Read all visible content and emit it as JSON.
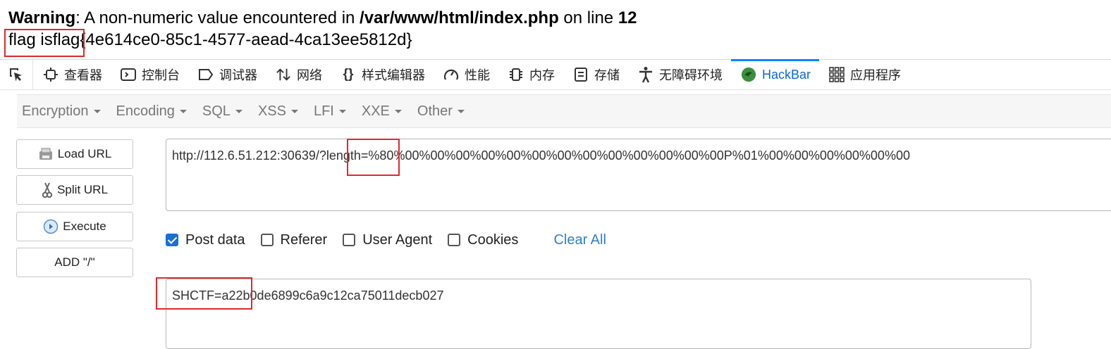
{
  "php_output": {
    "warning_label": "Warning",
    "warning_text": ": A non-numeric value encountered in ",
    "warning_file": "/var/www/html/index.php",
    "warning_on_line": " on line ",
    "warning_line": "12",
    "flag_line": "flag isflag{4e614ce0-85c1-4577-aead-4ca13ee5812d}"
  },
  "devtools": {
    "tabs": [
      {
        "label": "查看器",
        "icon": "inspector-icon"
      },
      {
        "label": "控制台",
        "icon": "console-icon"
      },
      {
        "label": "调试器",
        "icon": "debugger-icon"
      },
      {
        "label": "网络",
        "icon": "network-icon"
      },
      {
        "label": "样式编辑器",
        "icon": "style-editor-icon"
      },
      {
        "label": "性能",
        "icon": "performance-icon"
      },
      {
        "label": "内存",
        "icon": "memory-icon"
      },
      {
        "label": "存储",
        "icon": "storage-icon"
      },
      {
        "label": "无障碍环境",
        "icon": "accessibility-icon"
      },
      {
        "label": "HackBar",
        "icon": "hackbar-icon",
        "active": true
      },
      {
        "label": "应用程序",
        "icon": "application-icon"
      }
    ]
  },
  "hackbar": {
    "menu": [
      "Encryption",
      "Encoding",
      "SQL",
      "XSS",
      "LFI",
      "XXE",
      "Other"
    ],
    "buttons": {
      "load_url": "Load URL",
      "split_url": "Split URL",
      "execute": "Execute",
      "add_slash": "ADD \"/\""
    },
    "url": "http://112.6.51.212:30639/?length=%80%00%00%00%00%00%00%00%00%00%00%00%00%00P%01%00%00%00%00%00%00",
    "options": {
      "post_data": "Post data",
      "referer": "Referer",
      "user_agent": "User Agent",
      "cookies": "Cookies",
      "clear_all": "Clear All"
    },
    "post_body": "SHCTF=a22b0de6899c6a9c12ca75011decb027"
  },
  "colors": {
    "highlight_box": "#e0282e",
    "active_tab": "#0a68d9",
    "link": "#2f7fd0",
    "checkbox_on": "#1a6fd4"
  }
}
